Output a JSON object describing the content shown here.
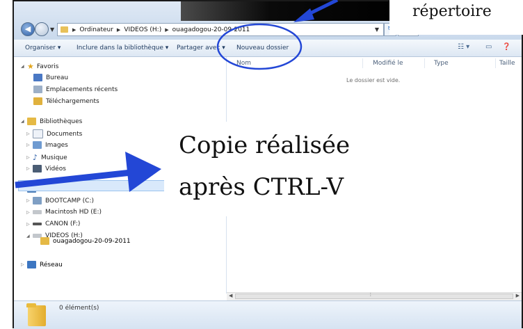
{
  "address": {
    "crumbs": [
      "Ordinateur",
      "VIDEOS (H:)",
      "ouagadogou-20-09-2011"
    ]
  },
  "toolbar": {
    "organize": "Organiser",
    "include_library": "Inclure dans la bibliothèque",
    "share_with": "Partager avec",
    "new_folder": "Nouveau dossier"
  },
  "sidebar": {
    "favorites": "Favoris",
    "fav_items": [
      "Bureau",
      "Emplacements récents",
      "Téléchargements"
    ],
    "libraries": "Bibliothèques",
    "lib_items": [
      "Documents",
      "Images",
      "Musique",
      "Vidéos"
    ],
    "computer": "Ordinateur",
    "drives": [
      "BOOTCAMP (C:)",
      "Macintosh HD (E:)",
      "CANON (F:)",
      "VIDEOS (H:)"
    ],
    "selected_folder": "ouagadogou-20-09-2011",
    "network": "Réseau"
  },
  "columns": [
    "Nom",
    "Modifié le",
    "Type",
    "Taille"
  ],
  "empty_message": "Le dossier est vide.",
  "details": {
    "count": "0 élément(s)"
  },
  "annotations": {
    "repertoire": "répertoire",
    "copy_line1": "Copie réalisée",
    "copy_line2": "après CTRL-V",
    "arrow_color": "#2347d6"
  }
}
